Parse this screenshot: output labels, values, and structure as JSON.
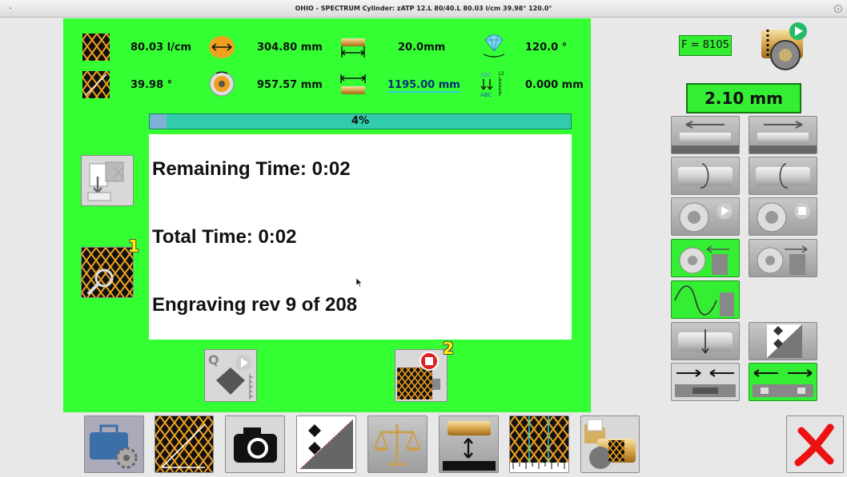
{
  "window": {
    "title": "OHIO - SPECTRUM    Cylinder: zATP 12.L    80/40.L    80.03 l/cm 39.98°  120.0°"
  },
  "params": {
    "lpi": "80.03 l/cm",
    "screen_angle": "39.98 °",
    "diameter": "304.80 mm",
    "circumference": "957.57 mm",
    "start_offset": "20.0mm",
    "engrave_width": "1195.00 mm",
    "stylus_angle": "120.0 °",
    "text_offset": "0.000 mm",
    "abc_superscript": "12"
  },
  "progress": {
    "percent": 4,
    "label": "4%"
  },
  "status": {
    "remaining": "Remaining Time: 0:02",
    "total": "Total Time: 0:02",
    "engraving": "Engraving rev 9 of 208"
  },
  "badges": {
    "inspect": "1",
    "stop": "2"
  },
  "right_panel": {
    "f_value": "F = 8105",
    "thickness": "2.10 mm"
  },
  "icons": {
    "inspect": "cell-magnifier-icon",
    "stop": "stop-engraving-icon",
    "quality": "quality-check-icon",
    "transfer": "document-transfer-icon"
  },
  "colors": {
    "panel_green": "#33ff33",
    "progress_teal": "#33ccaa",
    "cell_orange": "#f0a020"
  }
}
